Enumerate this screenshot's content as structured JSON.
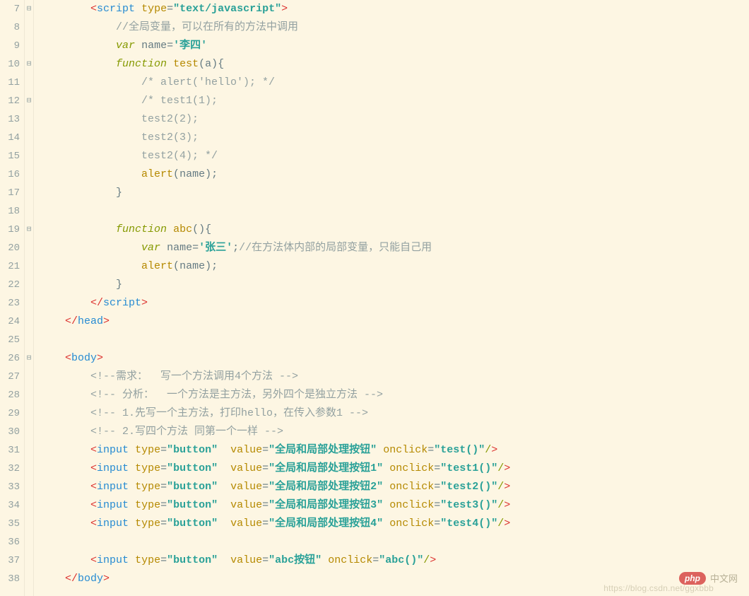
{
  "lines": [
    {
      "n": 7,
      "fold": "⊟",
      "tokens": [
        [
          "p",
          "        "
        ],
        [
          "br",
          "<"
        ],
        [
          "tg",
          "script"
        ],
        [
          "p",
          " "
        ],
        [
          "at",
          "type"
        ],
        [
          "eq",
          "="
        ],
        [
          "st",
          "\"text/javascript\""
        ],
        [
          "br",
          ">"
        ]
      ]
    },
    {
      "n": 8,
      "fold": "",
      "tokens": [
        [
          "p",
          "            "
        ],
        [
          "cm",
          "//全局变量，可以在所有的方法中调用"
        ]
      ]
    },
    {
      "n": 9,
      "fold": "",
      "tokens": [
        [
          "p",
          "            "
        ],
        [
          "kw",
          "var"
        ],
        [
          "p",
          " "
        ],
        [
          "nm",
          "name"
        ],
        [
          "eq",
          "="
        ],
        [
          "st",
          "'李四'"
        ]
      ]
    },
    {
      "n": 10,
      "fold": "⊟",
      "tokens": [
        [
          "p",
          "            "
        ],
        [
          "kw",
          "function"
        ],
        [
          "p",
          " "
        ],
        [
          "fn",
          "test"
        ],
        [
          "p",
          "("
        ],
        [
          "nm",
          "a"
        ],
        [
          "p",
          "){"
        ]
      ]
    },
    {
      "n": 11,
      "fold": "",
      "tokens": [
        [
          "p",
          "                "
        ],
        [
          "cm",
          "/* alert('hello'); */"
        ]
      ]
    },
    {
      "n": 12,
      "fold": "⊟",
      "tokens": [
        [
          "p",
          "                "
        ],
        [
          "cm",
          "/* test1(1);"
        ]
      ]
    },
    {
      "n": 13,
      "fold": "",
      "tokens": [
        [
          "p",
          "                "
        ],
        [
          "cm",
          "test2(2);"
        ]
      ]
    },
    {
      "n": 14,
      "fold": "",
      "tokens": [
        [
          "p",
          "                "
        ],
        [
          "cm",
          "test2(3);"
        ]
      ]
    },
    {
      "n": 15,
      "fold": "",
      "tokens": [
        [
          "p",
          "                "
        ],
        [
          "cm",
          "test2(4); */"
        ]
      ]
    },
    {
      "n": 16,
      "fold": "",
      "tokens": [
        [
          "p",
          "                "
        ],
        [
          "fn",
          "alert"
        ],
        [
          "p",
          "("
        ],
        [
          "nm",
          "name"
        ],
        [
          "p",
          ");"
        ]
      ]
    },
    {
      "n": 17,
      "fold": "",
      "tokens": [
        [
          "p",
          "            }"
        ]
      ]
    },
    {
      "n": 18,
      "fold": "",
      "tokens": [
        [
          "p",
          ""
        ]
      ]
    },
    {
      "n": 19,
      "fold": "⊟",
      "tokens": [
        [
          "p",
          "            "
        ],
        [
          "kw",
          "function"
        ],
        [
          "p",
          " "
        ],
        [
          "fn",
          "abc"
        ],
        [
          "p",
          "(){"
        ]
      ]
    },
    {
      "n": 20,
      "fold": "",
      "tokens": [
        [
          "p",
          "                "
        ],
        [
          "kw",
          "var"
        ],
        [
          "p",
          " "
        ],
        [
          "nm",
          "name"
        ],
        [
          "eq",
          "="
        ],
        [
          "st",
          "'张三'"
        ],
        [
          "p",
          ";"
        ],
        [
          "cm",
          "//在方法体内部的局部变量，只能自己用"
        ]
      ]
    },
    {
      "n": 21,
      "fold": "",
      "tokens": [
        [
          "p",
          "                "
        ],
        [
          "fn",
          "alert"
        ],
        [
          "p",
          "("
        ],
        [
          "nm",
          "name"
        ],
        [
          "p",
          ");"
        ]
      ]
    },
    {
      "n": 22,
      "fold": "",
      "tokens": [
        [
          "p",
          "            }"
        ]
      ]
    },
    {
      "n": 23,
      "fold": "",
      "tokens": [
        [
          "p",
          "        "
        ],
        [
          "br",
          "</"
        ],
        [
          "tg",
          "script"
        ],
        [
          "br",
          ">"
        ]
      ]
    },
    {
      "n": 24,
      "fold": "",
      "tokens": [
        [
          "p",
          "    "
        ],
        [
          "br",
          "</"
        ],
        [
          "tg",
          "head"
        ],
        [
          "br",
          ">"
        ]
      ]
    },
    {
      "n": 25,
      "fold": "",
      "tokens": [
        [
          "p",
          ""
        ]
      ]
    },
    {
      "n": 26,
      "fold": "⊟",
      "tokens": [
        [
          "p",
          "    "
        ],
        [
          "br",
          "<"
        ],
        [
          "tg",
          "body"
        ],
        [
          "br",
          ">"
        ]
      ]
    },
    {
      "n": 27,
      "fold": "",
      "tokens": [
        [
          "p",
          "        "
        ],
        [
          "cm",
          "<!--需求：  写一个方法调用4个方法 -->"
        ]
      ]
    },
    {
      "n": 28,
      "fold": "",
      "tokens": [
        [
          "p",
          "        "
        ],
        [
          "cm",
          "<!-- 分析：  一个方法是主方法，另外四个是独立方法 -->"
        ]
      ]
    },
    {
      "n": 29,
      "fold": "",
      "tokens": [
        [
          "p",
          "        "
        ],
        [
          "cm",
          "<!-- 1.先写一个主方法，打印hello，在传入参数1 -->"
        ]
      ]
    },
    {
      "n": 30,
      "fold": "",
      "tokens": [
        [
          "p",
          "        "
        ],
        [
          "cm",
          "<!-- 2.写四个方法 同第一个一样 -->"
        ]
      ]
    },
    {
      "n": 31,
      "fold": "",
      "tokens": [
        [
          "p",
          "        "
        ],
        [
          "br",
          "<"
        ],
        [
          "tg",
          "input"
        ],
        [
          "p",
          " "
        ],
        [
          "at",
          "type"
        ],
        [
          "eq",
          "="
        ],
        [
          "st",
          "\"button\""
        ],
        [
          "p",
          "  "
        ],
        [
          "at",
          "value"
        ],
        [
          "eq",
          "="
        ],
        [
          "st",
          "\"全局和局部处理按钮\""
        ],
        [
          "p",
          " "
        ],
        [
          "at",
          "onclick"
        ],
        [
          "eq",
          "="
        ],
        [
          "st",
          "\"test()\""
        ],
        [
          "op",
          "/"
        ],
        [
          "br",
          ">"
        ]
      ]
    },
    {
      "n": 32,
      "fold": "",
      "tokens": [
        [
          "p",
          "        "
        ],
        [
          "br",
          "<"
        ],
        [
          "tg",
          "input"
        ],
        [
          "p",
          " "
        ],
        [
          "at",
          "type"
        ],
        [
          "eq",
          "="
        ],
        [
          "st",
          "\"button\""
        ],
        [
          "p",
          "  "
        ],
        [
          "at",
          "value"
        ],
        [
          "eq",
          "="
        ],
        [
          "st",
          "\"全局和局部处理按钮1\""
        ],
        [
          "p",
          " "
        ],
        [
          "at",
          "onclick"
        ],
        [
          "eq",
          "="
        ],
        [
          "st",
          "\"test1()\""
        ],
        [
          "op",
          "/"
        ],
        [
          "br",
          ">"
        ]
      ]
    },
    {
      "n": 33,
      "fold": "",
      "tokens": [
        [
          "p",
          "        "
        ],
        [
          "br",
          "<"
        ],
        [
          "tg",
          "input"
        ],
        [
          "p",
          " "
        ],
        [
          "at",
          "type"
        ],
        [
          "eq",
          "="
        ],
        [
          "st",
          "\"button\""
        ],
        [
          "p",
          "  "
        ],
        [
          "at",
          "value"
        ],
        [
          "eq",
          "="
        ],
        [
          "st",
          "\"全局和局部处理按钮2\""
        ],
        [
          "p",
          " "
        ],
        [
          "at",
          "onclick"
        ],
        [
          "eq",
          "="
        ],
        [
          "st",
          "\"test2()\""
        ],
        [
          "op",
          "/"
        ],
        [
          "br",
          ">"
        ]
      ]
    },
    {
      "n": 34,
      "fold": "",
      "tokens": [
        [
          "p",
          "        "
        ],
        [
          "br",
          "<"
        ],
        [
          "tg",
          "input"
        ],
        [
          "p",
          " "
        ],
        [
          "at",
          "type"
        ],
        [
          "eq",
          "="
        ],
        [
          "st",
          "\"button\""
        ],
        [
          "p",
          "  "
        ],
        [
          "at",
          "value"
        ],
        [
          "eq",
          "="
        ],
        [
          "st",
          "\"全局和局部处理按钮3\""
        ],
        [
          "p",
          " "
        ],
        [
          "at",
          "onclick"
        ],
        [
          "eq",
          "="
        ],
        [
          "st",
          "\"test3()\""
        ],
        [
          "op",
          "/"
        ],
        [
          "br",
          ">"
        ]
      ]
    },
    {
      "n": 35,
      "fold": "",
      "tokens": [
        [
          "p",
          "        "
        ],
        [
          "br",
          "<"
        ],
        [
          "tg",
          "input"
        ],
        [
          "p",
          " "
        ],
        [
          "at",
          "type"
        ],
        [
          "eq",
          "="
        ],
        [
          "st",
          "\"button\""
        ],
        [
          "p",
          "  "
        ],
        [
          "at",
          "value"
        ],
        [
          "eq",
          "="
        ],
        [
          "st",
          "\"全局和局部处理按钮4\""
        ],
        [
          "p",
          " "
        ],
        [
          "at",
          "onclick"
        ],
        [
          "eq",
          "="
        ],
        [
          "st",
          "\"test4()\""
        ],
        [
          "op",
          "/"
        ],
        [
          "br",
          ">"
        ]
      ]
    },
    {
      "n": 36,
      "fold": "",
      "tokens": [
        [
          "p",
          ""
        ]
      ]
    },
    {
      "n": 37,
      "fold": "",
      "tokens": [
        [
          "p",
          "        "
        ],
        [
          "br",
          "<"
        ],
        [
          "tg",
          "input"
        ],
        [
          "p",
          " "
        ],
        [
          "at",
          "type"
        ],
        [
          "eq",
          "="
        ],
        [
          "st",
          "\"button\""
        ],
        [
          "p",
          "  "
        ],
        [
          "at",
          "value"
        ],
        [
          "eq",
          "="
        ],
        [
          "st",
          "\"abc按钮\""
        ],
        [
          "p",
          " "
        ],
        [
          "at",
          "onclick"
        ],
        [
          "eq",
          "="
        ],
        [
          "st",
          "\"abc()\""
        ],
        [
          "op",
          "/"
        ],
        [
          "br",
          ">"
        ]
      ]
    },
    {
      "n": 38,
      "fold": "",
      "tokens": [
        [
          "p",
          "    "
        ],
        [
          "br",
          "</"
        ],
        [
          "tg",
          "body"
        ],
        [
          "br",
          ">"
        ]
      ]
    }
  ],
  "watermark": {
    "badge": "php",
    "text": "中文网",
    "url": "https://blog.csdn.net/ggxbbb"
  }
}
